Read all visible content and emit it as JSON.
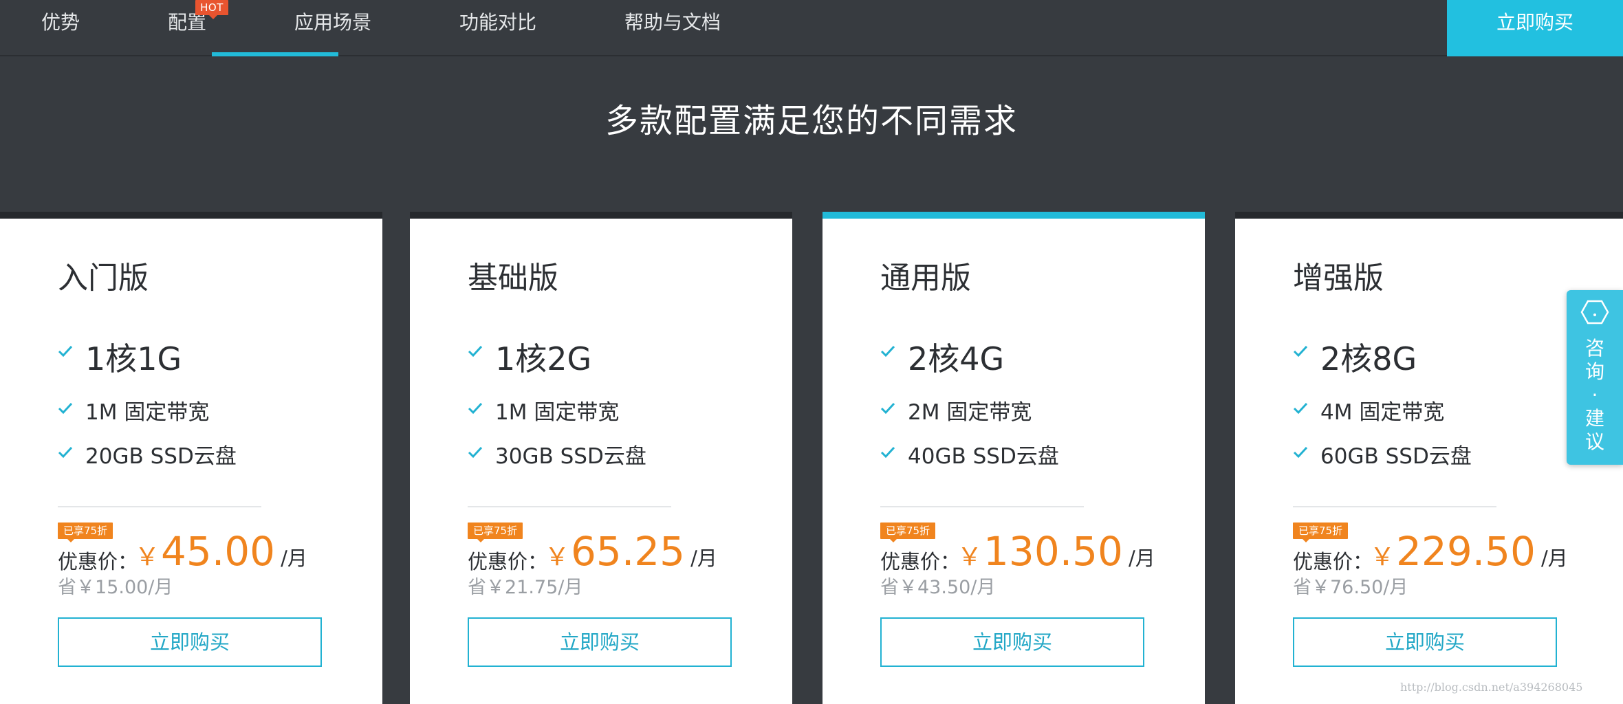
{
  "nav": {
    "items": [
      {
        "label": "优势"
      },
      {
        "label": "配置"
      },
      {
        "label": "应用场景"
      },
      {
        "label": "功能对比"
      },
      {
        "label": "帮助与文档"
      }
    ],
    "hot_badge": "HOT",
    "active_index": 2,
    "buy_label": "立即购买"
  },
  "headline": "多款配置满足您的不同需求",
  "plans": [
    {
      "name": "入门版",
      "spec": "1核1G",
      "bandwidth": "1M 固定带宽",
      "disk": "20GB SSD云盘",
      "discount": "已享75折",
      "price_label": "优惠价：",
      "currency": "￥",
      "price": "45.00",
      "unit": "/月",
      "save": "省￥15.00/月",
      "button": "立即购买",
      "highlighted": false
    },
    {
      "name": "基础版",
      "spec": "1核2G",
      "bandwidth": "1M 固定带宽",
      "disk": "30GB SSD云盘",
      "discount": "已享75折",
      "price_label": "优惠价：",
      "currency": "￥",
      "price": "65.25",
      "unit": "/月",
      "save": "省￥21.75/月",
      "button": "立即购买",
      "highlighted": false
    },
    {
      "name": "通用版",
      "spec": "2核4G",
      "bandwidth": "2M 固定带宽",
      "disk": "40GB SSD云盘",
      "discount": "已享75折",
      "price_label": "优惠价：",
      "currency": "￥",
      "price": "130.50",
      "unit": "/月",
      "save": "省￥43.50/月",
      "button": "立即购买",
      "highlighted": true
    },
    {
      "name": "增强版",
      "spec": "2核8G",
      "bandwidth": "4M 固定带宽",
      "disk": "60GB SSD云盘",
      "discount": "已享75折",
      "price_label": "优惠价：",
      "currency": "￥",
      "price": "229.50",
      "unit": "/月",
      "save": "省￥76.50/月",
      "button": "立即购买",
      "highlighted": false
    }
  ],
  "side_widget": {
    "chars": [
      "咨",
      "询",
      "·",
      "建",
      "议"
    ],
    "icon": "hexagon-icon"
  },
  "watermark": "http://blog.csdn.net/a394268045",
  "colors": {
    "background": "#373b40",
    "accent": "#22bbd9",
    "price": "#f0841e",
    "hot": "#e8542f"
  }
}
